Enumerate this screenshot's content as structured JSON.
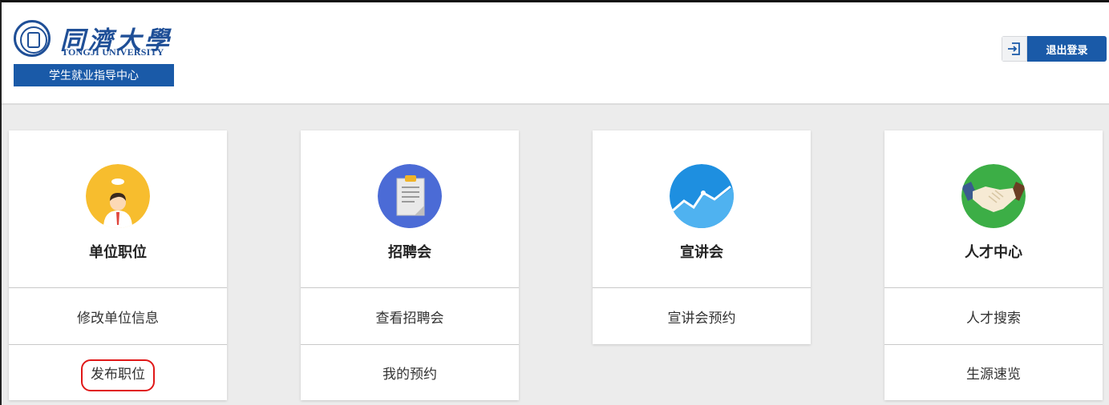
{
  "header": {
    "logo_cn": "同濟大學",
    "logo_en": "TONGJI UNIVERSITY",
    "subtitle": "学生就业指导中心",
    "logout_label": "退出登录",
    "logout_icon": "logout-icon"
  },
  "colors": {
    "brand_blue": "#1a5aa8",
    "page_bg": "#ececec",
    "highlight_red": "#e01818"
  },
  "cards": [
    {
      "title": "单位职位",
      "icon": "employee-icon",
      "links": [
        "修改单位信息",
        "发布职位"
      ]
    },
    {
      "title": "招聘会",
      "icon": "clipboard-icon",
      "links": [
        "查看招聘会",
        "我的预约"
      ]
    },
    {
      "title": "宣讲会",
      "icon": "trend-chart-icon",
      "links": [
        "宣讲会预约"
      ]
    },
    {
      "title": "人才中心",
      "icon": "handshake-icon",
      "links": [
        "人才搜索",
        "生源速览"
      ]
    }
  ]
}
